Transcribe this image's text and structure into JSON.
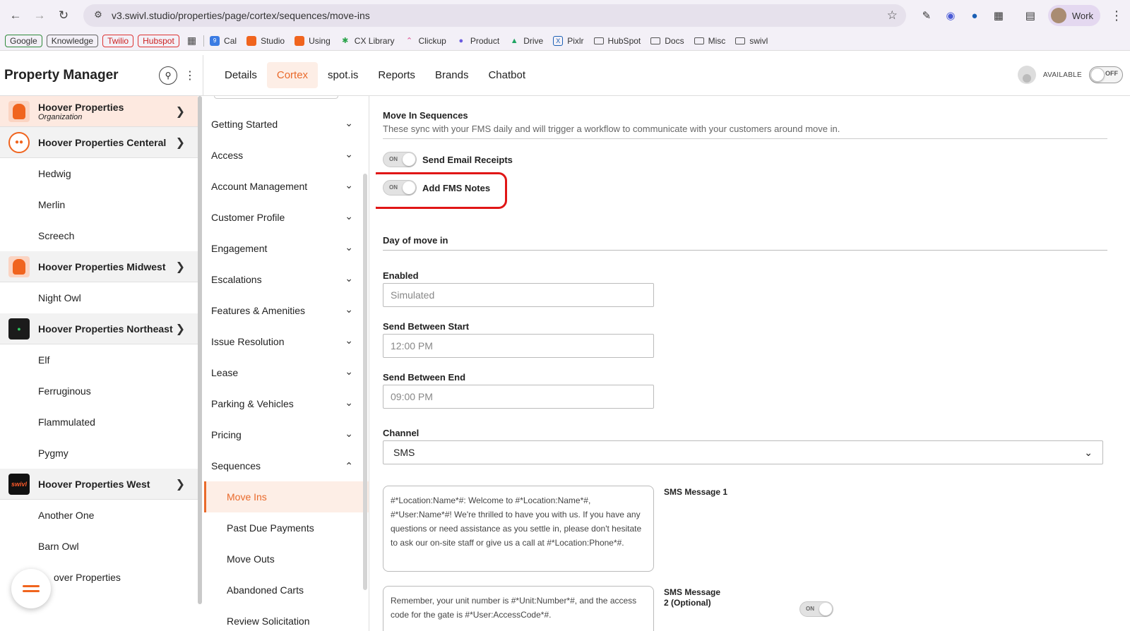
{
  "browser": {
    "url": "v3.swivl.studio/properties/page/cortex/sequences/move-ins",
    "profile_label": "Work"
  },
  "bookmarks": {
    "pills": [
      "Google",
      "Knowledge",
      "Twilio",
      "Hubspot"
    ],
    "items": [
      "Cal",
      "Studio",
      "Using",
      "CX Library",
      "Clickup",
      "Product",
      "Drive",
      "Pixlr"
    ],
    "folders": [
      "HubSpot",
      "Docs",
      "Misc",
      "swivl"
    ]
  },
  "app": {
    "title": "Property Manager",
    "tabs": [
      "Details",
      "Cortex",
      "spot.is",
      "Reports",
      "Brands",
      "Chatbot"
    ],
    "active_tab": "Cortex",
    "status_label": "AVAILABLE",
    "status_toggle": "OFF"
  },
  "sidebar": {
    "rows": [
      {
        "type": "org",
        "name": "Hoover Properties",
        "sub": "Organization",
        "logo": "orange",
        "highlight": true
      },
      {
        "type": "org",
        "name": "Hoover Properties Centeral",
        "logo": "circle"
      },
      {
        "type": "prop",
        "name": "Hedwig"
      },
      {
        "type": "prop",
        "name": "Merlin"
      },
      {
        "type": "prop",
        "name": "Screech"
      },
      {
        "type": "org",
        "name": "Hoover Properties Midwest",
        "logo": "orange"
      },
      {
        "type": "prop",
        "name": "Night Owl"
      },
      {
        "type": "org",
        "name": "Hoover Properties Northeast",
        "logo": "dark"
      },
      {
        "type": "prop",
        "name": "Elf"
      },
      {
        "type": "prop",
        "name": "Ferruginous"
      },
      {
        "type": "prop",
        "name": "Flammulated"
      },
      {
        "type": "prop",
        "name": "Pygmy"
      },
      {
        "type": "org",
        "name": "Hoover Properties West",
        "logo": "swivl"
      },
      {
        "type": "prop",
        "name": "Another One"
      },
      {
        "type": "prop",
        "name": "Barn Owl"
      },
      {
        "type": "prop",
        "name": "over Properties"
      }
    ],
    "swivl_logo_text": "swivl"
  },
  "midnav": {
    "sections": [
      "Getting Started",
      "Access",
      "Account Management",
      "Customer Profile",
      "Engagement",
      "Escalations",
      "Features & Amenities",
      "Issue Resolution",
      "Lease",
      "Parking & Vehicles",
      "Pricing"
    ],
    "open_section": "Sequences",
    "sub_items": [
      "Move Ins",
      "Past Due Payments",
      "Move Outs",
      "Abandoned Carts",
      "Review Solicitation"
    ],
    "active_sub": "Move Ins"
  },
  "main": {
    "title": "Move In Sequences",
    "description": "These sync with your FMS daily and will trigger a workflow to communicate with your customers around move in.",
    "toggles": [
      {
        "state": "ON",
        "label": "Send Email Receipts"
      },
      {
        "state": "ON",
        "label": "Add FMS Notes"
      }
    ],
    "day_section": "Day of move in",
    "fields": [
      {
        "label": "Enabled",
        "value": "Simulated"
      },
      {
        "label": "Send Between Start",
        "value": "12:00 PM"
      },
      {
        "label": "Send Between End",
        "value": "09:00 PM"
      }
    ],
    "channel_label": "Channel",
    "channel_value": "SMS",
    "messages": [
      {
        "label": "SMS Message 1",
        "text": "#*Location:Name*#: Welcome to #*Location:Name*#, #*User:Name*#! We're thrilled to have you with us. If you have any questions or need assistance as you settle in, please don't hesitate to ask our on-site staff or give us a call at #*Location:Phone*#."
      },
      {
        "label": "SMS Message 2 (Optional)",
        "text": "Remember, your unit number is #*Unit:Number*#, and the access code for the gate is #*User:AccessCode*#.",
        "toggle": "ON"
      }
    ]
  },
  "colors": {
    "accent": "#e96a2b",
    "highlight": "#e01616"
  }
}
